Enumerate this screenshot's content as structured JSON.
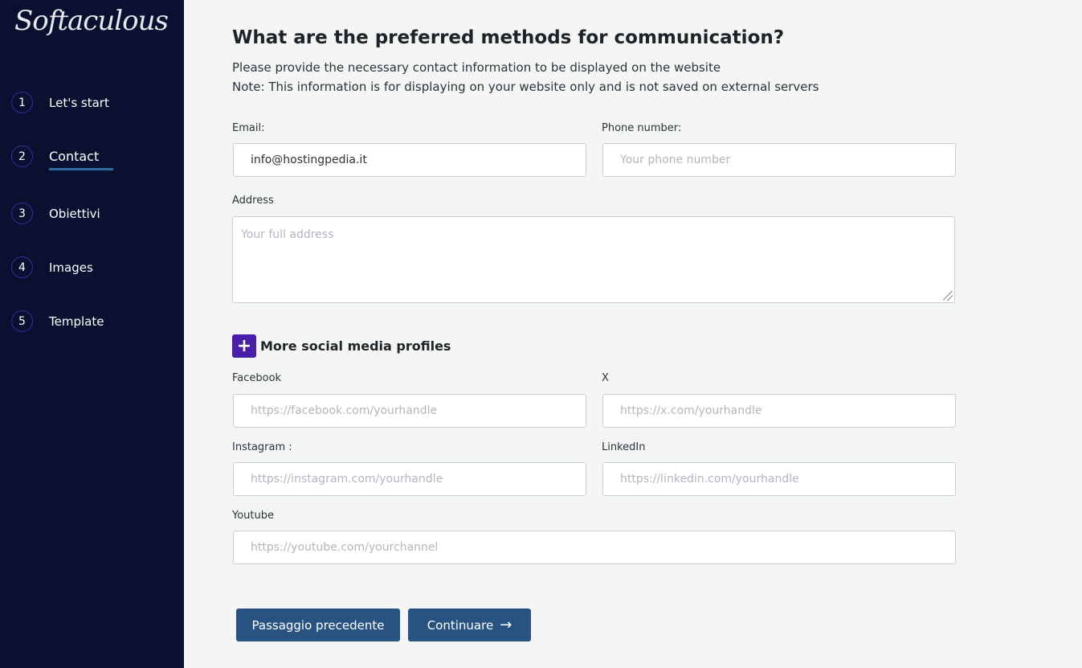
{
  "brand": {
    "logo_text": "Softaculous"
  },
  "steps": [
    {
      "num": "1",
      "label": "Let's start"
    },
    {
      "num": "2",
      "label": "Contact",
      "active": true
    },
    {
      "num": "3",
      "label": "Obiettivi"
    },
    {
      "num": "4",
      "label": "Images"
    },
    {
      "num": "5",
      "label": "Template"
    }
  ],
  "page": {
    "title": "What are the preferred methods for communication?",
    "subtitle": "Please provide the necessary contact information to be displayed on the website",
    "note": "Note: This information is for displaying on your website only and is not saved on external servers"
  },
  "fields": {
    "email": {
      "label": "Email:",
      "value": "info@hostingpedia.it"
    },
    "phone": {
      "label": "Phone number:",
      "placeholder": "Your phone number"
    },
    "address": {
      "label": "Address",
      "placeholder": "Your full address"
    }
  },
  "social": {
    "heading": "More social media profiles",
    "plus_glyph": "+",
    "facebook": {
      "label": "Facebook",
      "placeholder": "https://facebook.com/yourhandle"
    },
    "x": {
      "label": "X",
      "placeholder": "https://x.com/yourhandle"
    },
    "instagram": {
      "label": "Instagram :",
      "placeholder": "https://instagram.com/yourhandle"
    },
    "linkedin": {
      "label": "LinkedIn",
      "placeholder": "https://linkedin.com/yourhandle"
    },
    "youtube": {
      "label": "Youtube",
      "placeholder": "https://youtube.com/yourchannel"
    }
  },
  "buttons": {
    "previous": "Passaggio precedente",
    "continue": "Continuare",
    "continue_icon": "→"
  },
  "colors": {
    "sidebar_bg": "#0a1030",
    "accent_purple": "#4a1ea8",
    "button_blue": "#285380",
    "active_underline": "#2d6da3"
  }
}
